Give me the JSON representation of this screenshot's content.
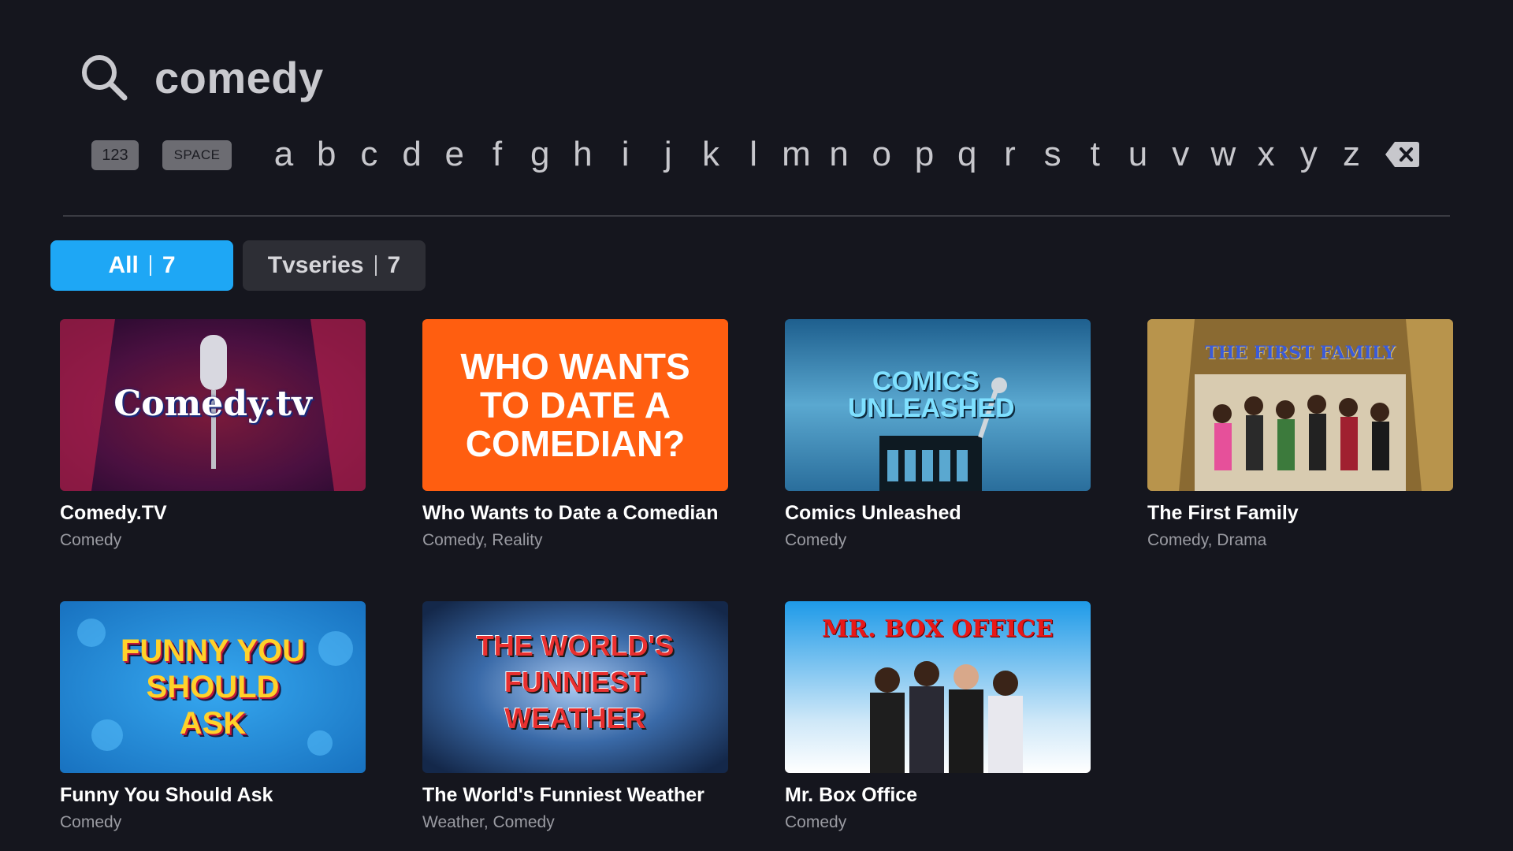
{
  "search": {
    "query": "comedy"
  },
  "keyboard": {
    "numbers_label": "123",
    "space_label": "SPACE",
    "letters": [
      "a",
      "b",
      "c",
      "d",
      "e",
      "f",
      "g",
      "h",
      "i",
      "j",
      "k",
      "l",
      "m",
      "n",
      "o",
      "p",
      "q",
      "r",
      "s",
      "t",
      "u",
      "v",
      "w",
      "x",
      "y",
      "z"
    ]
  },
  "tabs": [
    {
      "label": "All",
      "count": "7",
      "selected": true
    },
    {
      "label": "Tvseries",
      "count": "7",
      "selected": false
    }
  ],
  "results": [
    {
      "title": "Comedy.TV",
      "genre": "Comedy",
      "art_text": "Comedy.tv"
    },
    {
      "title": "Who Wants to Date a Comedian",
      "genre": "Comedy, Reality",
      "art_text": "WHO WANTS TO DATE A COMEDIAN?"
    },
    {
      "title": "Comics Unleashed",
      "genre": "Comedy",
      "art_text": "COMICS UNLEASHED"
    },
    {
      "title": "The First Family",
      "genre": "Comedy, Drama",
      "art_text": "THE FIRST FAMILY"
    },
    {
      "title": "Funny You Should Ask",
      "genre": "Comedy",
      "art_text": "FUNNY YOU SHOULD ASK"
    },
    {
      "title": "The World's Funniest Weather",
      "genre": "Weather, Comedy",
      "art_text": "THE WORLD'S FUNNIEST WEATHER"
    },
    {
      "title": "Mr. Box Office",
      "genre": "Comedy",
      "art_text": "MR. BOX OFFICE"
    }
  ],
  "colors": {
    "background": "#15161e",
    "accent": "#1ea7f5",
    "tab_inactive": "#2d2e35"
  }
}
